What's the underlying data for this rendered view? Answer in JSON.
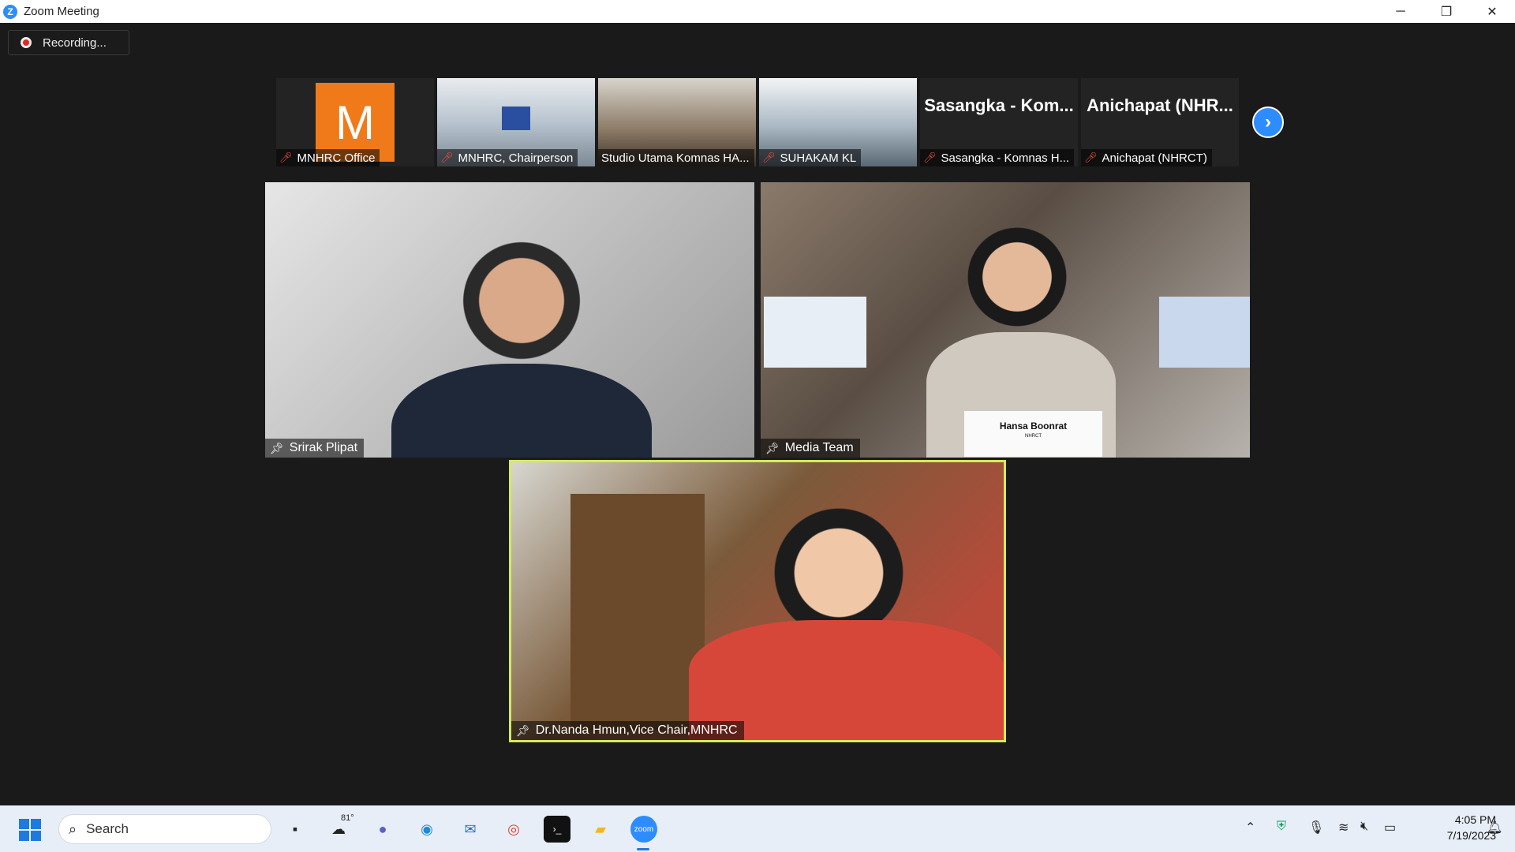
{
  "window": {
    "title": "Zoom Meeting",
    "controls": {
      "minimize": "─",
      "restore": "❐",
      "close": "✕"
    }
  },
  "recording": {
    "label": "Recording..."
  },
  "thumbnails": [
    {
      "name": "MNHRC Office",
      "avatar_letter": "M",
      "muted": true
    },
    {
      "name": "MNHRC, Chairperson",
      "muted": true
    },
    {
      "name": "Studio Utama Komnas HA...",
      "muted": false
    },
    {
      "name": "SUHAKAM KL",
      "muted": true
    },
    {
      "name": "Sasangka - Komnas H...",
      "display_name": "Sasangka - Kom...",
      "muted": true
    },
    {
      "name": "Anichapat (NHRCT)",
      "display_name": "Anichapat (NHR...",
      "muted": true
    }
  ],
  "videos": [
    {
      "name": "Srirak Plipat"
    },
    {
      "name": "Media Team",
      "placard": "Hansa Boonrat",
      "placard_sub": "NHRCT"
    },
    {
      "name": "Dr.Nanda Hmun,Vice Chair,MNHRC",
      "active_speaker": true
    }
  ],
  "taskbar": {
    "search_placeholder": "Search",
    "weather": "81°",
    "time": "4:05 PM",
    "date": "7/19/2023"
  },
  "colors": {
    "accent": "#2d8cff",
    "active_speaker_border": "#d4ea5a",
    "avatar": "#f07a1a",
    "muted": "#e74c3c"
  }
}
